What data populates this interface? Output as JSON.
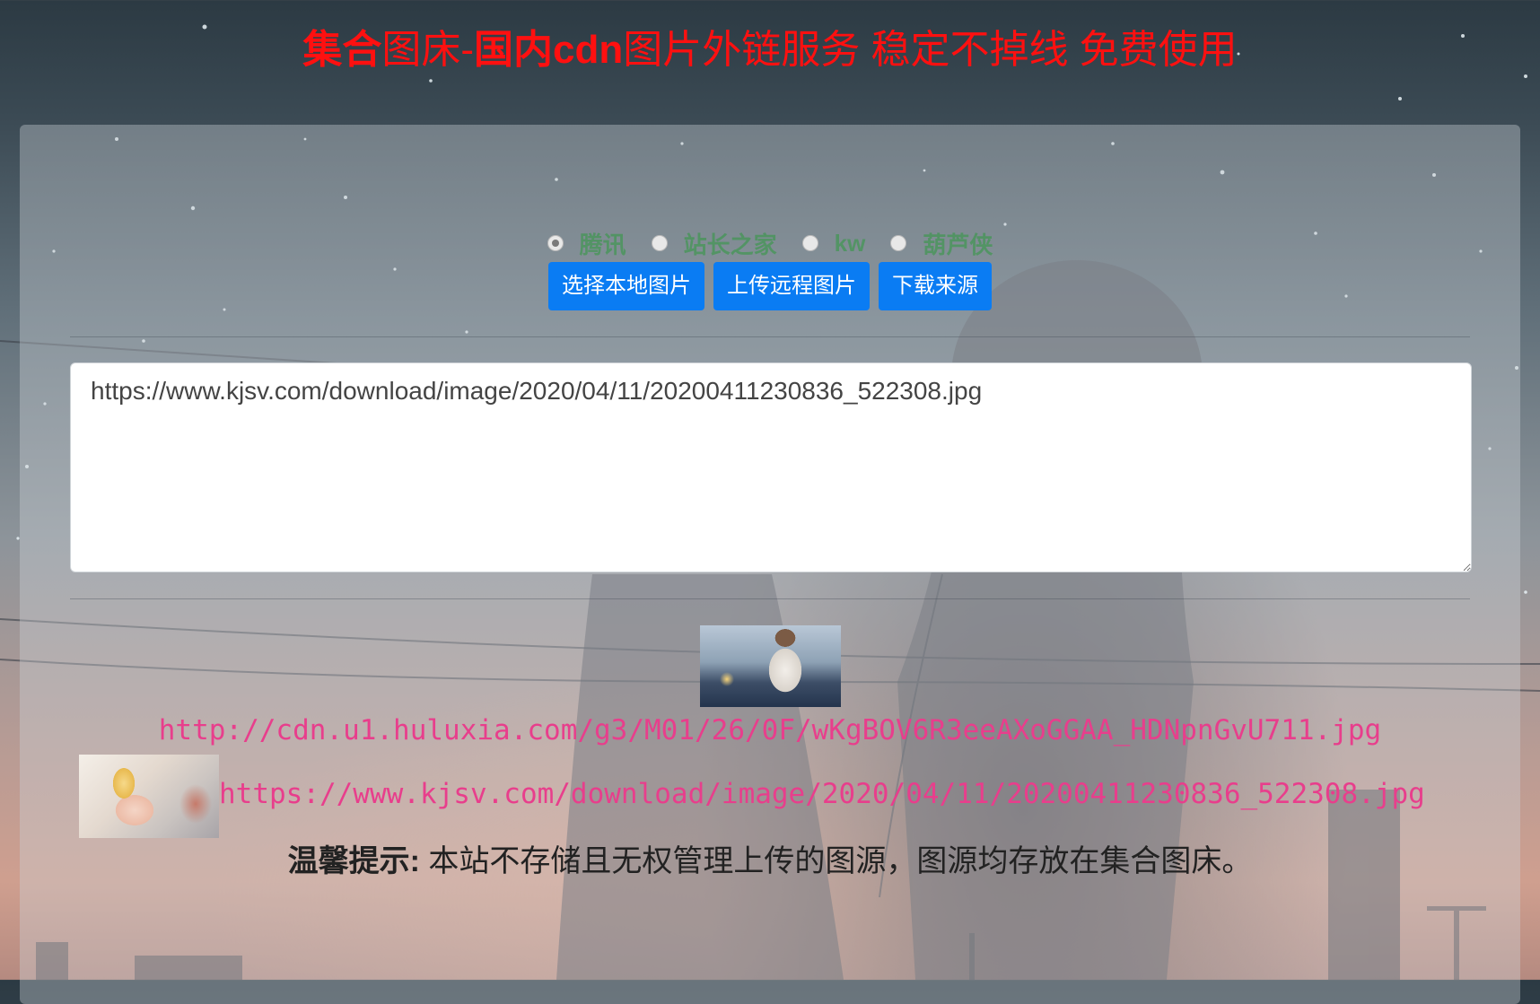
{
  "header": {
    "title_strong_1": "集合",
    "title_mid": "图床-",
    "title_strong_2": "国内cdn",
    "title_rest": "图片外链服务 稳定不掉线 免费使用"
  },
  "source_options": [
    {
      "label": "腾讯",
      "checked": true
    },
    {
      "label": "站长之家",
      "checked": false
    },
    {
      "label": "kw",
      "checked": false
    },
    {
      "label": "葫芦侠",
      "checked": false
    }
  ],
  "buttons": {
    "select_local": "选择本地图片",
    "upload_remote": "上传远程图片",
    "download_source": "下载来源"
  },
  "url_input": {
    "value": "https://www.kjsv.com/download/image/2020/04/11/20200411230836_522308.jpg"
  },
  "results": [
    {
      "url": "http://cdn.u1.huluxia.com/g3/M01/26/0F/wKgBOV6R3eeAXoGGAA_HDNpnGvU711.jpg"
    },
    {
      "url": "https://www.kjsv.com/download/image/2020/04/11/20200411230836_522308.jpg"
    }
  ],
  "notice": {
    "label": "温馨提示:",
    "text": " 本站不存储且无权管理上传的图源，图源均存放在集合图床。"
  },
  "colors": {
    "title_red": "#ff1010",
    "button_blue": "#0a7cf3",
    "link_pink": "#e83e8c",
    "radio_green": "#2e9a3e"
  }
}
